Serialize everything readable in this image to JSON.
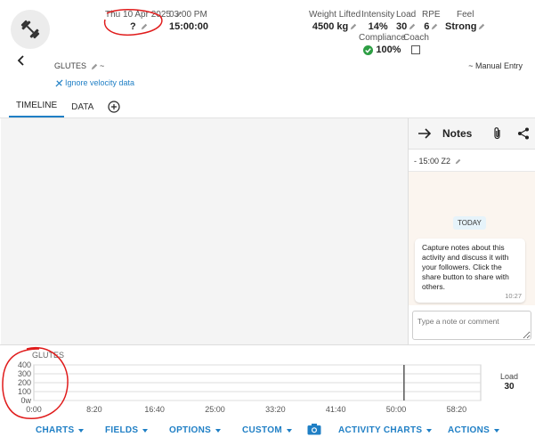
{
  "header": {
    "date": "Thu 10 Apr 2025",
    "date_value": "?",
    "time": "03:00 PM",
    "time_value": "15:00:00",
    "metrics": [
      {
        "label": "Weight Lifted",
        "value": "4500 kg"
      },
      {
        "label": "Intensity",
        "value": "14%"
      },
      {
        "label": "Load",
        "value": "30"
      },
      {
        "label": "RPE",
        "value": "6"
      },
      {
        "label": "Feel",
        "value": "Strong"
      }
    ],
    "compliance_label": "Compliance",
    "compliance_value": "100%",
    "coach_label": "Coach"
  },
  "activity": {
    "name": "GLUTES",
    "name_suffix": "~",
    "manual_entry": "~ Manual Entry",
    "ignore_velocity": "Ignore velocity data"
  },
  "tabs": [
    {
      "label": "TIMELINE",
      "active": true
    },
    {
      "label": "DATA",
      "active": false
    }
  ],
  "notes": {
    "title": "Notes",
    "time_entry": "- 15:00 Z2",
    "today_badge": "TODAY",
    "message": "Capture notes about this activity and discuss it with your followers. Click the share button to share with others.",
    "message_time": "10:27",
    "input_placeholder": "Type a note or comment"
  },
  "chart_data": {
    "type": "line",
    "title": "GLUTES",
    "y_ticks": [
      "400",
      "300",
      "200",
      "100",
      "0w"
    ],
    "x_ticks": [
      "0:00",
      "8:20",
      "16:40",
      "25:00",
      "33:20",
      "41:40",
      "50:00",
      "58:20"
    ],
    "ylim": [
      0,
      400
    ],
    "grid": true,
    "marker_x": "~51:00",
    "side_label": "Load",
    "side_value": "30"
  },
  "toolbar": {
    "charts": "CHARTS",
    "fields": "FIELDS",
    "options": "OPTIONS",
    "custom": "CUSTOM",
    "activity_charts": "ACTIVITY CHARTS",
    "actions": "ACTIONS"
  },
  "colors": {
    "accent": "#1f7fc5",
    "compliance": "#2e9e44",
    "annotation": "#e01b1b"
  }
}
